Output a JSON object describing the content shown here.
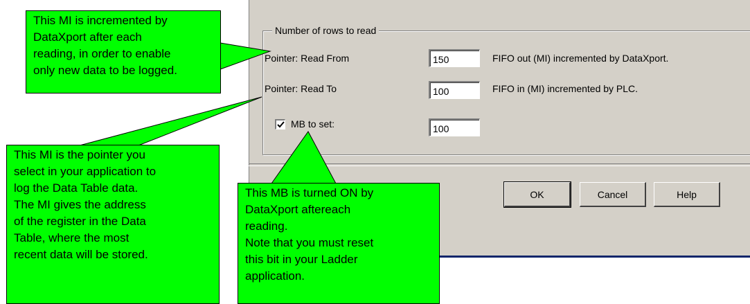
{
  "dialog": {
    "group_title": "Number of rows to read",
    "rows": [
      {
        "label": "Pointer: Read From",
        "value": "150",
        "note": "FIFO out (MI) incremented by DataXport."
      },
      {
        "label": "Pointer: Read To",
        "value": "100",
        "note": "FIFO in (MI) incremented by PLC."
      }
    ],
    "mb": {
      "label": "MB to set:",
      "checked": true,
      "value": "100"
    },
    "buttons": {
      "ok": "OK",
      "cancel": "Cancel",
      "help": "Help"
    }
  },
  "callouts": {
    "top_left": "This MI is incremented by\nDataXport after each\nreading, in order to enable\nonly new data to be logged.",
    "bottom_left": "This MI is the pointer  you\nselect in your application to\nlog the Data Table data.\nThe MI gives the address\nof the register in the Data\nTable, where the most\nrecent data will be stored.",
    "bottom_center": "This MB is turned ON by\nDataXport aftereach\nreading.\nNote that you must reset\nthis bit in your Ladder\napplication."
  },
  "colors": {
    "callout_fill": "#00ff00",
    "dialog_face": "#d4d0c8",
    "title_bar_edge": "#0a246a"
  }
}
